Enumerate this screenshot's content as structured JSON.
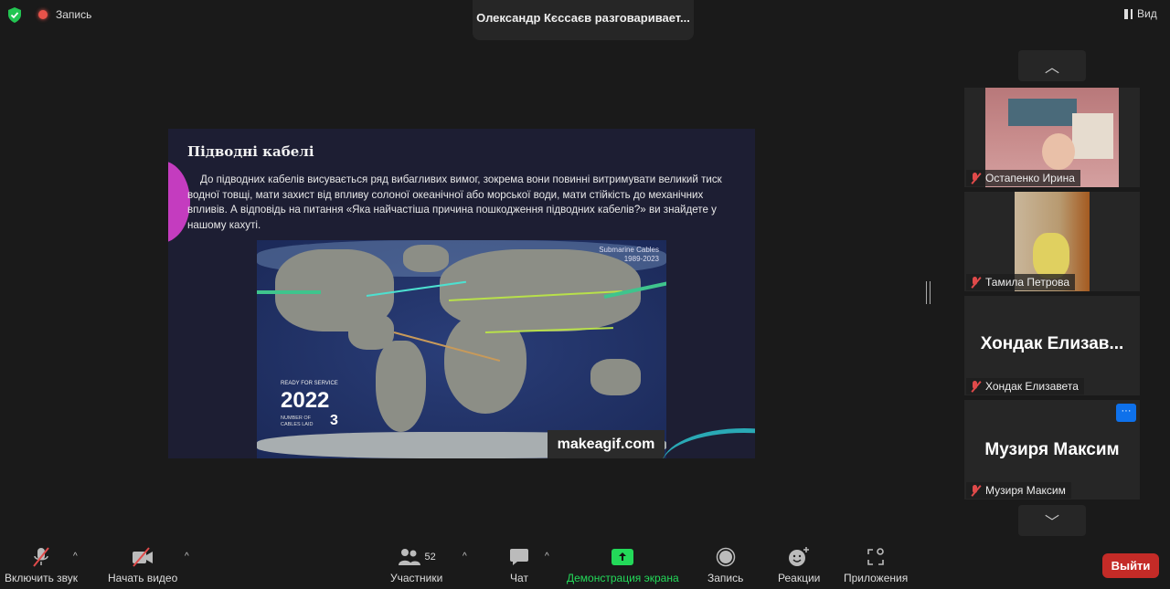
{
  "topbar": {
    "recording_label": "Запись",
    "active_speaker": "Олександр Кєссаєв разговаривает...",
    "view_label": "Вид"
  },
  "slide": {
    "title": "Підводні кабелі",
    "body": "До підводних кабелів висувається ряд вибагливих вимог, зокрема вони повинні витримувати великий тиск водної товщі, мати захист від впливу солоної океанічної або морської води, мати стійкість до механічних впливів. А відповідь на питання «Яка найчастіша причина пошкодження підводних кабелів?» ви знайдете у нашому кахуті.",
    "map": {
      "title": "Submarine Cables",
      "years": "1989-2023",
      "ready_label": "READY FOR SERVICE",
      "year": "2022",
      "cables_label": "NUMBER OF CABLES LAID",
      "cables_count": "3",
      "watermark": "makeagif.com"
    }
  },
  "participants": [
    {
      "name": "Остапенко Ирина",
      "video": true
    },
    {
      "name": "Тамила Петрова",
      "video": true
    },
    {
      "name": "Хондак Елизавета",
      "display": "Хондак  Елизав...",
      "video": false
    },
    {
      "name": "Музиря Максим",
      "display": "Музиря Максим",
      "video": false
    }
  ],
  "toolbar": {
    "unmute": "Включить звук",
    "start_video": "Начать видео",
    "participants": "Участники",
    "participants_count": "52",
    "chat": "Чат",
    "share": "Демонстрация экрана",
    "record": "Запись",
    "reactions": "Реакции",
    "apps": "Приложения",
    "leave": "Выйти"
  },
  "colors": {
    "share": "#23d959",
    "leave": "#c42b27",
    "accent": "#0e71eb"
  }
}
